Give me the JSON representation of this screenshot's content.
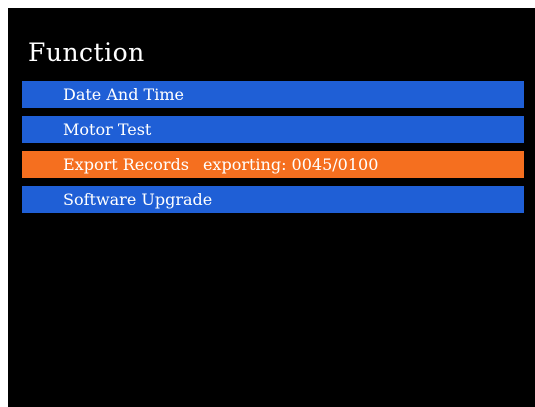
{
  "screen": {
    "title": "Function"
  },
  "menu": {
    "items": [
      {
        "label": "Date And Time",
        "status": ""
      },
      {
        "label": "Motor Test",
        "status": ""
      },
      {
        "label": "Export Records",
        "status": "exporting: 0045/0100"
      },
      {
        "label": "Software Upgrade",
        "status": ""
      }
    ],
    "selected_index": 2
  },
  "colors": {
    "background": "#000000",
    "item": "#1f5fd6",
    "item_selected": "#f56f1f",
    "text": "#ffffff"
  }
}
